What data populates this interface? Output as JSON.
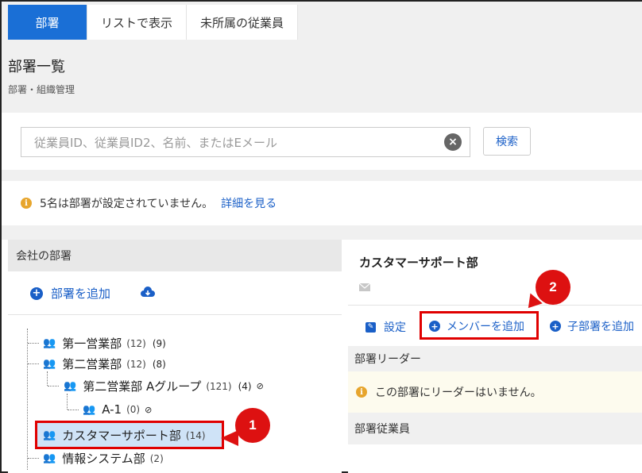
{
  "tabs": [
    {
      "label": "部署"
    },
    {
      "label": "リストで表示"
    },
    {
      "label": "未所属の従業員"
    }
  ],
  "header": {
    "title": "部署一覧",
    "subtitle": "部署・組織管理"
  },
  "search": {
    "placeholder": "従業員ID、従業員ID2、名前、またはEメール",
    "button_label": "検索"
  },
  "notice": {
    "text": "5名は部署が設定されていません。",
    "link": "詳細を見る"
  },
  "left_panel": {
    "header": "会社の部署",
    "add_label": "部署を追加"
  },
  "tree": [
    {
      "name": "第一営業部",
      "count": "(12)",
      "count2": "(9)"
    },
    {
      "name": "第二営業部",
      "count": "(12)",
      "count2": "(8)"
    },
    {
      "name": "第二営業部 Aグループ",
      "count": "(121)",
      "count2": "(4)"
    },
    {
      "name": "A-1",
      "count": "(0)",
      "count2": ""
    },
    {
      "name": "カスタマーサポート部",
      "count": "(14)",
      "count2": ""
    },
    {
      "name": "情報システム部",
      "count": "(2)",
      "count2": ""
    }
  ],
  "right_panel": {
    "title": "カスタマーサポート部",
    "actions": {
      "settings": "設定",
      "add_member": "メンバーを追加",
      "add_child": "子部署を追加"
    },
    "leader_header": "部署リーダー",
    "leader_notice": "この部署にリーダーはいません。",
    "members_header": "部署従業員"
  },
  "callouts": [
    "1",
    "2"
  ],
  "colors": {
    "accent": "#1a6fd6",
    "highlight": "#e00000",
    "selected_bg": "#cfe3f7"
  }
}
